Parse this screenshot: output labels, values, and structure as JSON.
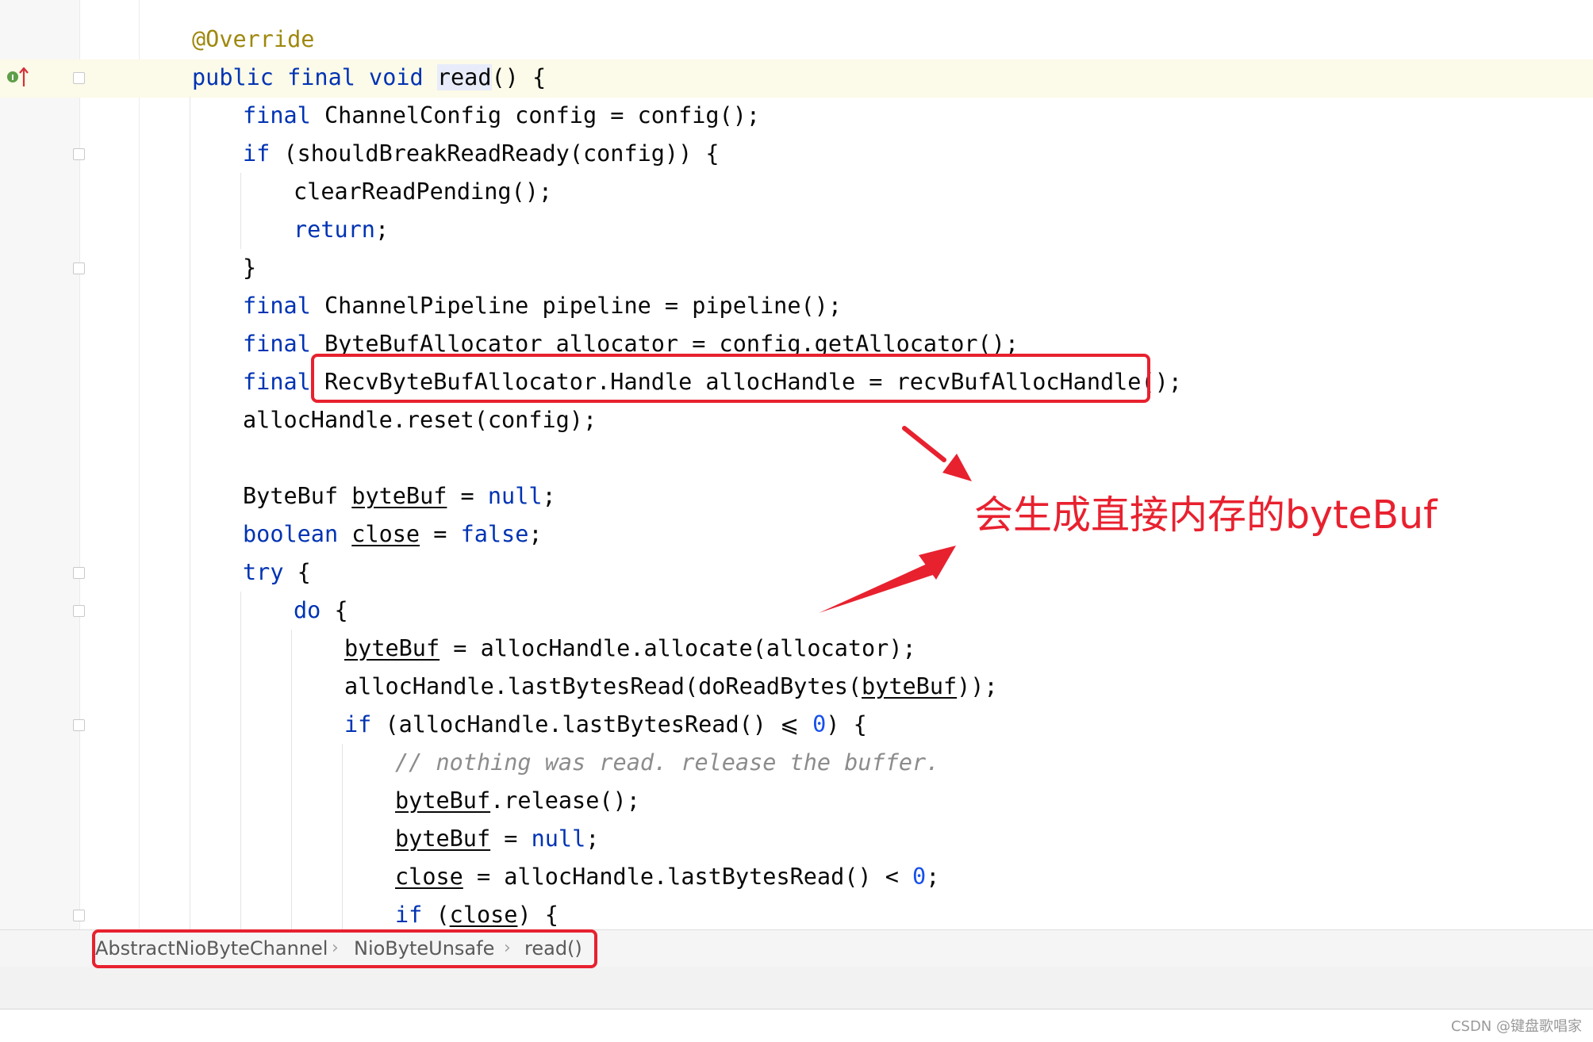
{
  "editor": {
    "lines": [
      {
        "indent": 0,
        "tokens": [
          {
            "c": "ann",
            "t": "@Override"
          }
        ]
      },
      {
        "indent": 0,
        "tokens": [
          {
            "c": "kw",
            "t": "public final void "
          },
          {
            "c": "meth",
            "t": "read"
          },
          {
            "c": "",
            "t": "() {"
          }
        ]
      },
      {
        "indent": 1,
        "tokens": [
          {
            "c": "kw",
            "t": "final "
          },
          {
            "c": "",
            "t": "ChannelConfig config = config();"
          }
        ]
      },
      {
        "indent": 1,
        "tokens": [
          {
            "c": "kw",
            "t": "if "
          },
          {
            "c": "",
            "t": "(shouldBreakReadReady(config)) {"
          }
        ]
      },
      {
        "indent": 2,
        "tokens": [
          {
            "c": "",
            "t": "clearReadPending();"
          }
        ]
      },
      {
        "indent": 2,
        "tokens": [
          {
            "c": "kw",
            "t": "return"
          },
          {
            "c": "",
            "t": ";"
          }
        ]
      },
      {
        "indent": 1,
        "tokens": [
          {
            "c": "",
            "t": "}"
          }
        ]
      },
      {
        "indent": 1,
        "tokens": [
          {
            "c": "kw",
            "t": "final "
          },
          {
            "c": "",
            "t": "ChannelPipeline pipeline = pipeline();"
          }
        ]
      },
      {
        "indent": 1,
        "tokens": [
          {
            "c": "kw",
            "t": "final "
          },
          {
            "c": "",
            "t": "ByteBufAllocator allocator = config.getAllocator();"
          }
        ]
      },
      {
        "indent": 1,
        "tokens": [
          {
            "c": "kw",
            "t": "final "
          },
          {
            "c": "",
            "t": "RecvByteBufAllocator.Handle allocHandle = recvBufAllocHandle();"
          }
        ]
      },
      {
        "indent": 1,
        "tokens": [
          {
            "c": "",
            "t": "allocHandle.reset(config);"
          }
        ]
      },
      {
        "indent": 0,
        "tokens": []
      },
      {
        "indent": 1,
        "tokens": [
          {
            "c": "",
            "t": "ByteBuf "
          },
          {
            "c": "u",
            "t": "byteBuf"
          },
          {
            "c": "",
            "t": " = "
          },
          {
            "c": "kw",
            "t": "null"
          },
          {
            "c": "",
            "t": ";"
          }
        ]
      },
      {
        "indent": 1,
        "tokens": [
          {
            "c": "kw",
            "t": "boolean "
          },
          {
            "c": "u",
            "t": "close"
          },
          {
            "c": "",
            "t": " = "
          },
          {
            "c": "kw",
            "t": "false"
          },
          {
            "c": "",
            "t": ";"
          }
        ]
      },
      {
        "indent": 1,
        "tokens": [
          {
            "c": "kw",
            "t": "try "
          },
          {
            "c": "",
            "t": "{"
          }
        ]
      },
      {
        "indent": 2,
        "tokens": [
          {
            "c": "kw",
            "t": "do "
          },
          {
            "c": "",
            "t": "{"
          }
        ]
      },
      {
        "indent": 3,
        "tokens": [
          {
            "c": "u",
            "t": "byteBuf"
          },
          {
            "c": "",
            "t": " = allocHandle.allocate(allocator);"
          }
        ]
      },
      {
        "indent": 3,
        "tokens": [
          {
            "c": "",
            "t": "allocHandle.lastBytesRead(doReadBytes("
          },
          {
            "c": "u",
            "t": "byteBuf"
          },
          {
            "c": "",
            "t": "));"
          }
        ]
      },
      {
        "indent": 3,
        "tokens": [
          {
            "c": "kw",
            "t": "if "
          },
          {
            "c": "",
            "t": "(allocHandle.lastBytesRead() ⩽ "
          },
          {
            "c": "num",
            "t": "0"
          },
          {
            "c": "",
            "t": ") {"
          }
        ]
      },
      {
        "indent": 4,
        "tokens": [
          {
            "c": "cmt",
            "t": "// nothing was read. release the buffer."
          }
        ]
      },
      {
        "indent": 4,
        "tokens": [
          {
            "c": "u",
            "t": "byteBuf"
          },
          {
            "c": "",
            "t": ".release();"
          }
        ]
      },
      {
        "indent": 4,
        "tokens": [
          {
            "c": "u",
            "t": "byteBuf"
          },
          {
            "c": "",
            "t": " = "
          },
          {
            "c": "kw",
            "t": "null"
          },
          {
            "c": "",
            "t": ";"
          }
        ]
      },
      {
        "indent": 4,
        "tokens": [
          {
            "c": "u",
            "t": "close"
          },
          {
            "c": "",
            "t": " = allocHandle.lastBytesRead() < "
          },
          {
            "c": "num",
            "t": "0"
          },
          {
            "c": "",
            "t": ";"
          }
        ]
      },
      {
        "indent": 4,
        "tokens": [
          {
            "c": "kw",
            "t": "if "
          },
          {
            "c": "",
            "t": "("
          },
          {
            "c": "u",
            "t": "close"
          },
          {
            "c": "",
            "t": ") {"
          }
        ]
      }
    ]
  },
  "breadcrumb": {
    "items": [
      "AbstractNioByteChannel",
      "NioByteUnsafe",
      "read()"
    ],
    "separator": "›"
  },
  "annotation": {
    "text": "会生成直接内存的byteBuf",
    "color": "#e8212f"
  },
  "gutter": {
    "implements_icon": "implements-method-icon",
    "icon_letter": "I"
  },
  "watermark": "CSDN @键盘歌唱家"
}
